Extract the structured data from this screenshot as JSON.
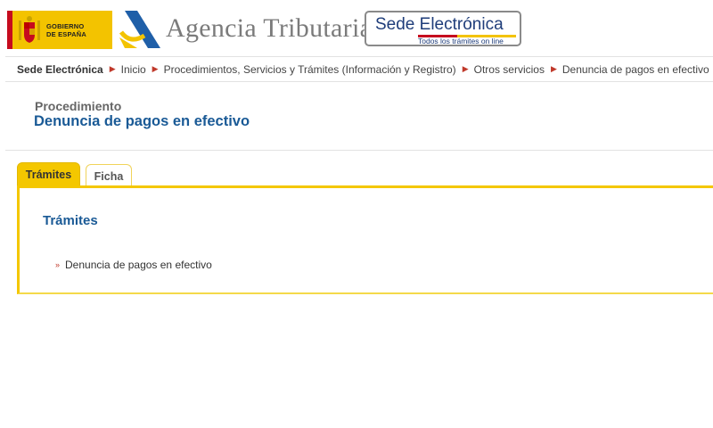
{
  "header": {
    "gobierno_text": "GOBIERNO\nDE ESPAÑA",
    "agency_name": "Agencia Tributaria",
    "sede_title": "Sede Electrónica",
    "sede_subtitle": "Todos los trámites on line"
  },
  "breadcrumb": {
    "items": [
      "Sede Electrónica",
      "Inicio",
      "Procedimientos, Servicios y Trámites (Información y Registro)",
      "Otros servicios",
      "Denuncia de pagos en efectivo"
    ]
  },
  "page": {
    "label": "Procedimiento",
    "title": "Denuncia de pagos en efectivo"
  },
  "tabs": [
    {
      "label": "Trámites",
      "active": true
    },
    {
      "label": "Ficha",
      "active": false
    }
  ],
  "panel": {
    "heading": "Trámites",
    "items": [
      {
        "label": "Denuncia de pagos en efectivo",
        "icon": "chevron-right-icon"
      }
    ]
  },
  "colors": {
    "accent_yellow": "#f4c700",
    "title_blue": "#1a5a96",
    "bullet_red": "#c0392b",
    "flag_red": "#c60b1e"
  }
}
